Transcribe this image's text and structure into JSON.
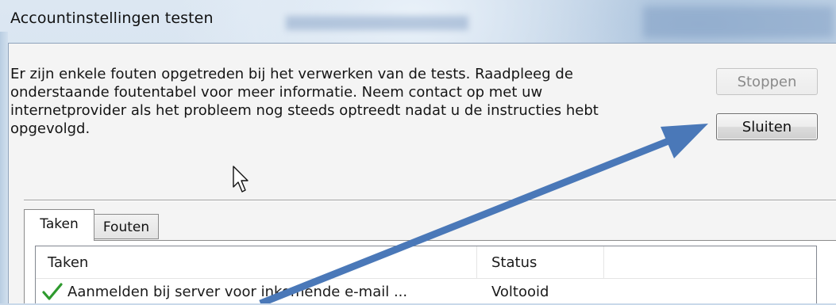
{
  "window": {
    "title": "Accountinstellingen testen"
  },
  "message": {
    "text": "Er zijn enkele fouten opgetreden bij het verwerken van de tests. Raadpleeg de\nonderstaande foutentabel voor meer informatie. Neem contact op met uw\ninternetprovider als het probleem nog steeds optreedt nadat u de instructies hebt\nopgevolgd."
  },
  "buttons": {
    "stop_label": "Stoppen",
    "close_label": "Sluiten"
  },
  "tabs": [
    {
      "label": "Taken",
      "selected": true
    },
    {
      "label": "Fouten",
      "selected": false
    }
  ],
  "table": {
    "columns": [
      "Taken",
      "Status"
    ],
    "rows": [
      {
        "task": "Aanmelden bij server voor inkomende e-mail ...",
        "status": "Voltooid",
        "icon": "check-icon"
      }
    ]
  },
  "annotation": {
    "arrow_color": "#4a78b8",
    "points_to": "close-button"
  },
  "colors": {
    "check": "#2e9a2e",
    "disabled_text": "#8a8a8a"
  }
}
